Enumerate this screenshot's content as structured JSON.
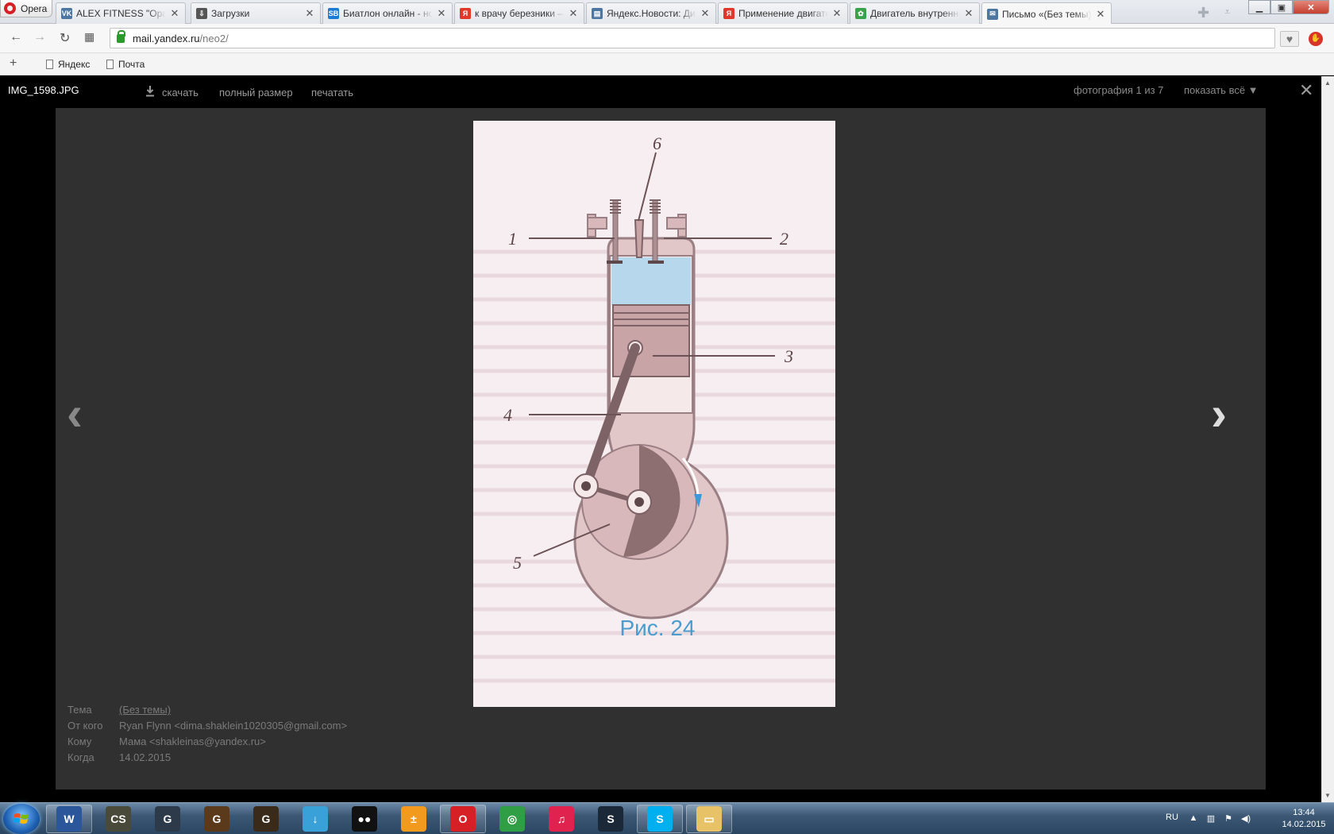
{
  "browser": {
    "app_name": "Opera",
    "tabs": [
      {
        "favicon": "VK",
        "fav_color": "#4d76a1",
        "title": "ALEX FITNESS \"Оранж Ф"
      },
      {
        "favicon": "⇩",
        "fav_color": "#555555",
        "title": "Загрузки"
      },
      {
        "favicon": "SB",
        "fav_color": "#1a7bd6",
        "title": "Биатлон онлайн - ново"
      },
      {
        "favicon": "Я",
        "fav_color": "#e2382a",
        "title": "к врачу березники — Я"
      },
      {
        "favicon": "▤",
        "fav_color": "#4d76a1",
        "title": "Яндекс.Новости: Динам"
      },
      {
        "favicon": "Я",
        "fav_color": "#e2382a",
        "title": "Применение двигател"
      },
      {
        "favicon": "✿",
        "fav_color": "#3aa24a",
        "title": "Двигатель внутреннего"
      },
      {
        "favicon": "✉",
        "fav_color": "#4d76a1",
        "title": "Письмо «(Без темы)» –"
      }
    ],
    "active_tab_index": 7,
    "url_host": "mail.yandex.ru",
    "url_path": "/neo2/",
    "bookmarks": [
      "Яндекс",
      "Почта"
    ],
    "newtab_icon": "plus-icon",
    "window_controls": [
      "minimize",
      "maximize",
      "close"
    ]
  },
  "viewer": {
    "filename": "IMG_1598.JPG",
    "actions": {
      "download": "скачать",
      "full_size": "полный размер",
      "print": "печатать"
    },
    "counter": "фотография 1 из 7",
    "show_all": "показать всё ▼",
    "close_icon": "close-icon",
    "prev_icon": "chevron-left-icon",
    "next_icon": "chevron-right-icon"
  },
  "photo": {
    "caption": "Рис. 24",
    "labels": [
      "1",
      "2",
      "3",
      "4",
      "5",
      "6"
    ],
    "caption_color": "#4b9ccd",
    "gas_color": "#b7d8ec"
  },
  "message": {
    "subject_label": "Тема",
    "subject": "(Без темы)",
    "from_label": "От кого",
    "from": "Ryan Flynn <dima.shaklein1020305@gmail.com>",
    "to_label": "Кому",
    "to": "Мама <shakleinas@yandex.ru>",
    "date_label": "Когда",
    "date": "14.02.2015"
  },
  "taskbar": {
    "apps": [
      {
        "name": "word",
        "label": "W",
        "color": "#2b579a",
        "open": true
      },
      {
        "name": "counter-strike",
        "label": "CS",
        "color": "#4a4a3a",
        "open": false
      },
      {
        "name": "game-1",
        "label": "G",
        "color": "#2d3a4a",
        "open": false
      },
      {
        "name": "game-2",
        "label": "G",
        "color": "#5a3a1a",
        "open": false
      },
      {
        "name": "game-3",
        "label": "G",
        "color": "#3a2a1a",
        "open": false
      },
      {
        "name": "downloader",
        "label": "↓",
        "color": "#3aa0d8",
        "open": false
      },
      {
        "name": "panda",
        "label": "●●",
        "color": "#111111",
        "open": false
      },
      {
        "name": "calculator",
        "label": "±",
        "color": "#f29a1e",
        "open": false
      },
      {
        "name": "opera",
        "label": "O",
        "color": "#d71f26",
        "open": true
      },
      {
        "name": "chrome",
        "label": "◎",
        "color": "#2f9e44",
        "open": false
      },
      {
        "name": "itunes",
        "label": "♫",
        "color": "#e0224e",
        "open": false
      },
      {
        "name": "steam",
        "label": "S",
        "color": "#1b2838",
        "open": false
      },
      {
        "name": "skype",
        "label": "S",
        "color": "#00aff0",
        "open": true
      },
      {
        "name": "explorer",
        "label": "▭",
        "color": "#e8c266",
        "open": true
      }
    ],
    "lang": "RU",
    "time": "13:44",
    "date": "14.02.2015"
  }
}
